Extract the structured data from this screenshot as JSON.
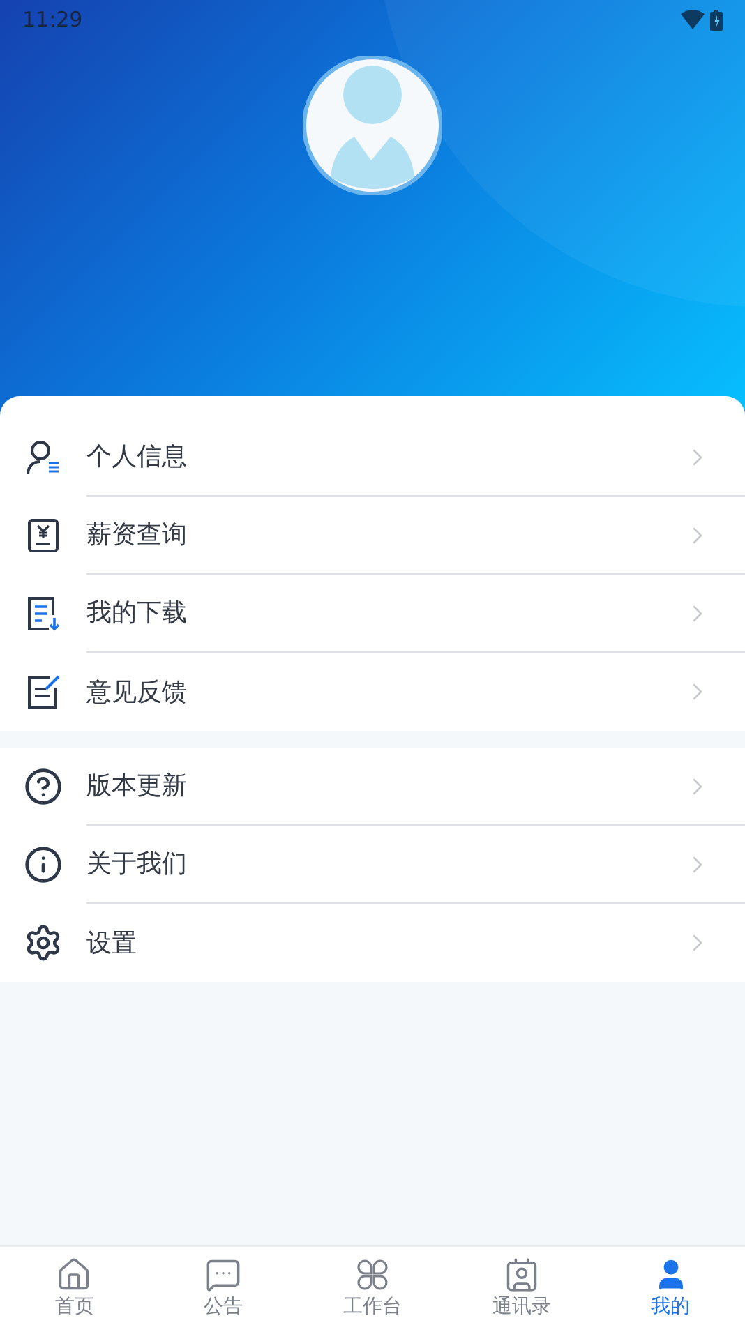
{
  "status_bar": {
    "time": "11:29"
  },
  "menu_groups": [
    {
      "items": [
        {
          "label": "个人信息"
        },
        {
          "label": "薪资查询"
        },
        {
          "label": "我的下载"
        },
        {
          "label": "意见反馈"
        }
      ]
    },
    {
      "items": [
        {
          "label": "版本更新"
        },
        {
          "label": "关于我们"
        },
        {
          "label": "设置"
        }
      ]
    }
  ],
  "tab_bar": [
    {
      "label": "首页",
      "selected": false
    },
    {
      "label": "公告",
      "selected": false
    },
    {
      "label": "工作台",
      "selected": false
    },
    {
      "label": "通讯录",
      "selected": false
    },
    {
      "label": "我的",
      "selected": true
    }
  ]
}
